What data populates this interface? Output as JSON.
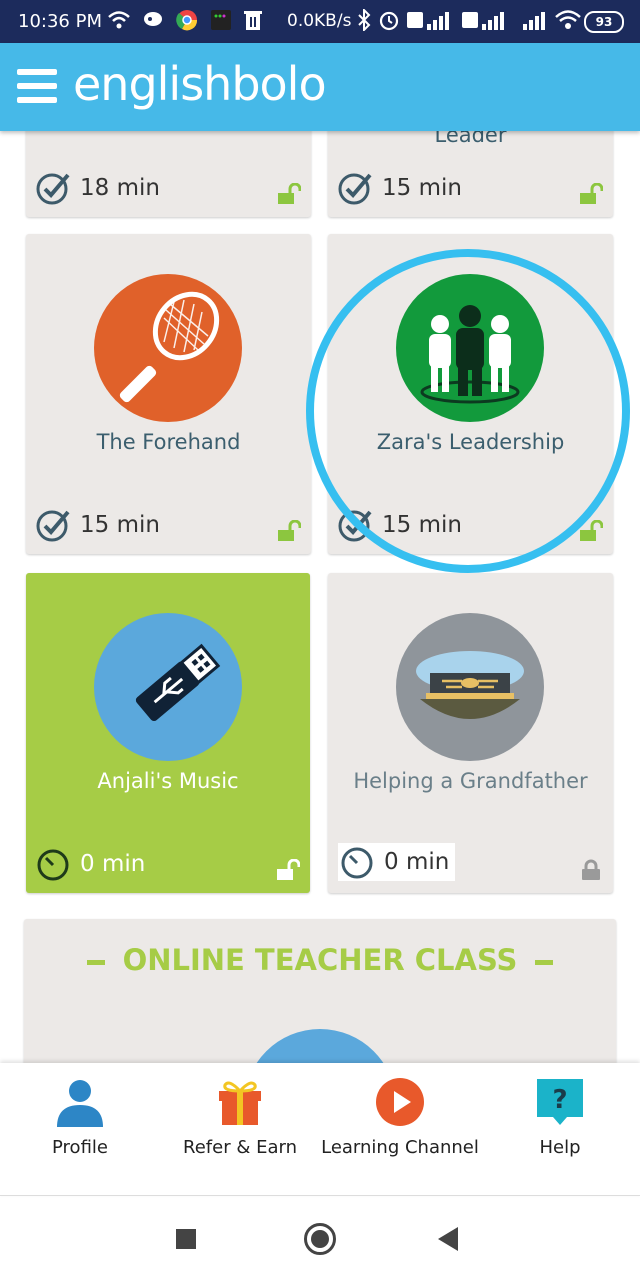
{
  "status_bar": {
    "time": "10:36 PM",
    "speed": "0.0KB/s",
    "battery": "93"
  },
  "app_bar": {
    "brand": "englishbolo"
  },
  "lessons": [
    {
      "title": "Leader",
      "duration": "15 min",
      "lock": "unlocked"
    },
    {
      "title": "",
      "duration": "18 min",
      "lock": "unlocked"
    },
    {
      "title": "The Forehand",
      "duration": "15 min",
      "lock": "unlocked"
    },
    {
      "title": "Zara's Leadership",
      "duration": "15 min",
      "lock": "unlocked"
    },
    {
      "title": "Anjali's Music",
      "duration": "0 min",
      "lock": "unlocked"
    },
    {
      "title": "Helping a Grandfather",
      "duration": "0 min",
      "lock": "locked"
    }
  ],
  "online_class": {
    "title": "ONLINE TEACHER CLASS"
  },
  "bottom_nav": [
    {
      "label": "Profile",
      "icon": "profile-icon"
    },
    {
      "label": "Refer & Earn",
      "icon": "gift-icon"
    },
    {
      "label": "Learning Channel",
      "icon": "play-icon"
    },
    {
      "label": "Help",
      "icon": "help-icon"
    }
  ],
  "colors": {
    "accent": "#46b9e8",
    "highlight": "#36bff0",
    "lime": "#a6cc46",
    "orange": "#e0612a",
    "green": "#129a3c",
    "status": "#1c2b5c"
  }
}
